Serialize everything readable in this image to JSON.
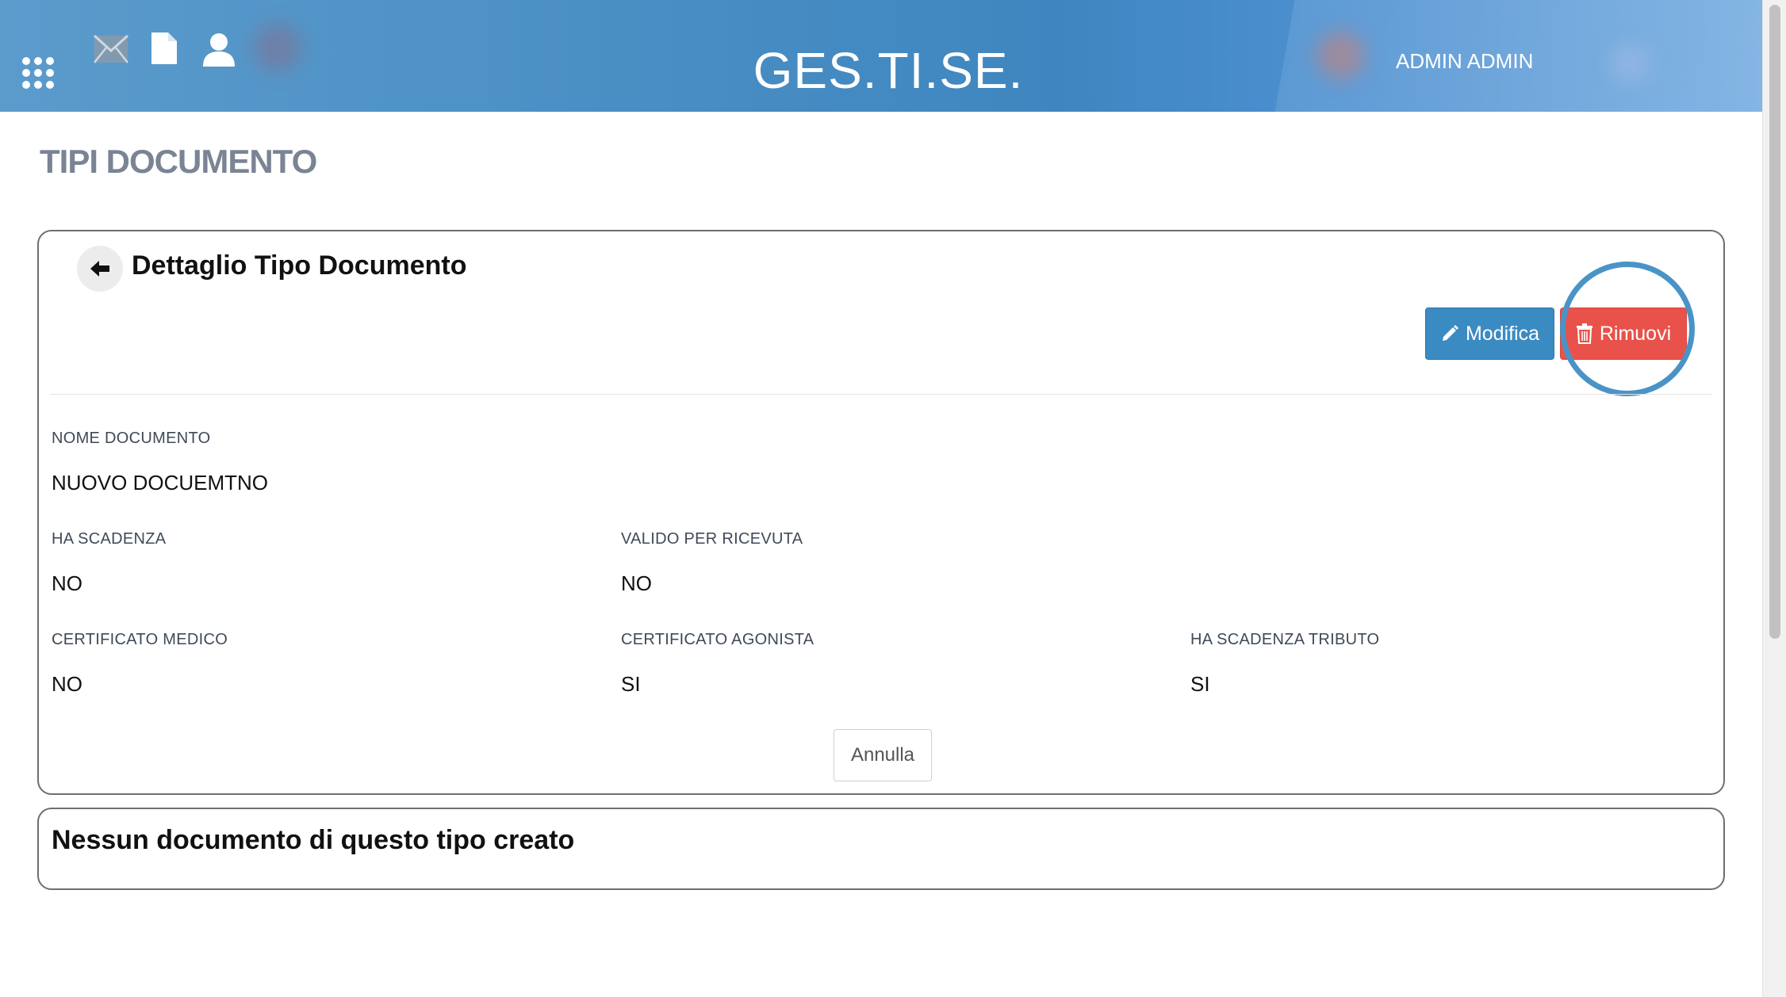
{
  "header": {
    "title": "GES.TI.SE.",
    "user": "ADMIN ADMIN"
  },
  "page": {
    "title": "TIPI DOCUMENTO"
  },
  "detail": {
    "title": "Dettaglio Tipo Documento",
    "edit_label": "Modifica",
    "remove_label": "Rimuovi",
    "cancel_label": "Annulla",
    "fields": [
      {
        "label": "NOME DOCUMENTO",
        "value": "NUOVO DOCUEMTNO"
      },
      {
        "label": "HA SCADENZA",
        "value": "NO"
      },
      {
        "label": "VALIDO PER RICEVUTA",
        "value": "NO"
      },
      {
        "label": "CERTIFICATO MEDICO",
        "value": "NO"
      },
      {
        "label": "CERTIFICATO AGONISTA",
        "value": "SI"
      },
      {
        "label": "HA SCADENZA TRIBUTO",
        "value": "SI"
      }
    ]
  },
  "empty_message": "Nessun documento di questo tipo creato",
  "icons": {
    "apps": "apps-grid-icon",
    "mail": "mail-icon",
    "document": "document-icon",
    "user": "user-icon",
    "back": "arrow-left-icon",
    "edit": "pencil-icon",
    "remove": "trash-icon"
  },
  "colors": {
    "header": "#4a8fc4",
    "edit_button": "#3b8bc3",
    "remove_button": "#e8524a",
    "highlight": "#4a93c6",
    "page_title": "#7a8494"
  }
}
